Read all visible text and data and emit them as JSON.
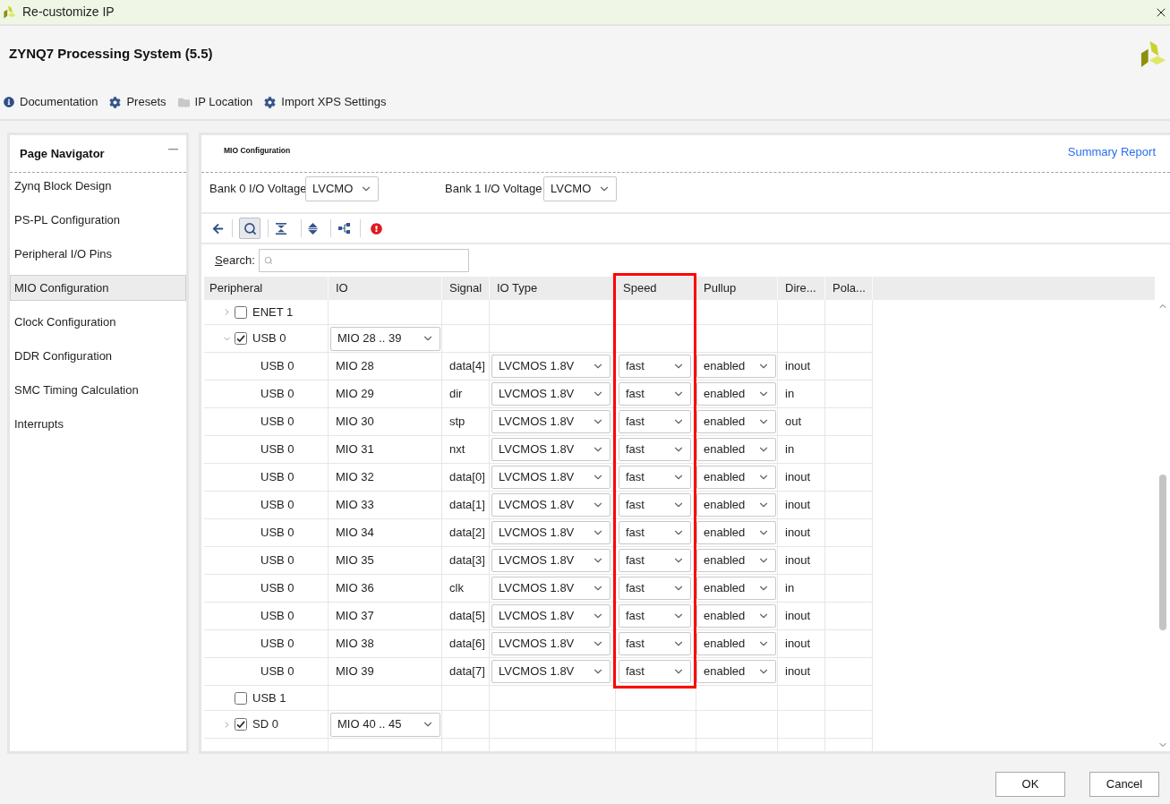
{
  "window": {
    "title": "Re-customize IP"
  },
  "header": {
    "title": "ZYNQ7 Processing System (5.5)",
    "links": [
      {
        "label": "Documentation"
      },
      {
        "label": "Presets"
      },
      {
        "label": "IP Location"
      },
      {
        "label": "Import XPS Settings"
      }
    ]
  },
  "navigator": {
    "title": "Page Navigator",
    "items": [
      {
        "label": "Zynq Block Design",
        "selected": false
      },
      {
        "label": "PS-PL Configuration",
        "selected": false
      },
      {
        "label": "Peripheral I/O Pins",
        "selected": false
      },
      {
        "label": "MIO Configuration",
        "selected": true
      },
      {
        "label": "Clock Configuration",
        "selected": false
      },
      {
        "label": "DDR Configuration",
        "selected": false
      },
      {
        "label": "SMC Timing Calculation",
        "selected": false
      },
      {
        "label": "Interrupts",
        "selected": false
      }
    ]
  },
  "panel": {
    "title": "MIO Configuration",
    "link": "Summary Report",
    "bank_voltages": [
      {
        "label": "Bank 0 I/O Voltage",
        "value": "LVCMO"
      },
      {
        "label": "Bank 1 I/O Voltage",
        "value": "LVCMO"
      }
    ],
    "toolbar": {
      "search_on": true
    },
    "search": {
      "label": "Search:"
    },
    "table": {
      "columns": [
        {
          "label": "Peripheral",
          "highlighted": false
        },
        {
          "label": "IO",
          "highlighted": false
        },
        {
          "label": "Signal",
          "highlighted": false
        },
        {
          "label": "IO Type",
          "highlighted": false
        },
        {
          "label": "Speed",
          "highlighted": true
        },
        {
          "label": "Pullup",
          "highlighted": false
        },
        {
          "label": "Dire...",
          "highlighted": false
        },
        {
          "label": "Pola...",
          "highlighted": false
        }
      ],
      "rows": [
        {
          "kind": "group",
          "peripheral": "ENET 1",
          "checked": false,
          "expanded": false
        },
        {
          "kind": "group",
          "peripheral": "USB 0",
          "checked": true,
          "expanded": true,
          "io": "MIO 28 .. 39",
          "children": [
            {
              "peripheral": "USB 0",
              "io": "MIO 28",
              "signal": "data[4]",
              "io_type": "LVCMOS 1.8V",
              "speed": "fast",
              "pullup": "enabled",
              "direction": "inout"
            },
            {
              "peripheral": "USB 0",
              "io": "MIO 29",
              "signal": "dir",
              "io_type": "LVCMOS 1.8V",
              "speed": "fast",
              "pullup": "enabled",
              "direction": "in"
            },
            {
              "peripheral": "USB 0",
              "io": "MIO 30",
              "signal": "stp",
              "io_type": "LVCMOS 1.8V",
              "speed": "fast",
              "pullup": "enabled",
              "direction": "out"
            },
            {
              "peripheral": "USB 0",
              "io": "MIO 31",
              "signal": "nxt",
              "io_type": "LVCMOS 1.8V",
              "speed": "fast",
              "pullup": "enabled",
              "direction": "in"
            },
            {
              "peripheral": "USB 0",
              "io": "MIO 32",
              "signal": "data[0]",
              "io_type": "LVCMOS 1.8V",
              "speed": "fast",
              "pullup": "enabled",
              "direction": "inout"
            },
            {
              "peripheral": "USB 0",
              "io": "MIO 33",
              "signal": "data[1]",
              "io_type": "LVCMOS 1.8V",
              "speed": "fast",
              "pullup": "enabled",
              "direction": "inout"
            },
            {
              "peripheral": "USB 0",
              "io": "MIO 34",
              "signal": "data[2]",
              "io_type": "LVCMOS 1.8V",
              "speed": "fast",
              "pullup": "enabled",
              "direction": "inout"
            },
            {
              "peripheral": "USB 0",
              "io": "MIO 35",
              "signal": "data[3]",
              "io_type": "LVCMOS 1.8V",
              "speed": "fast",
              "pullup": "enabled",
              "direction": "inout"
            },
            {
              "peripheral": "USB 0",
              "io": "MIO 36",
              "signal": "clk",
              "io_type": "LVCMOS 1.8V",
              "speed": "fast",
              "pullup": "enabled",
              "direction": "in"
            },
            {
              "peripheral": "USB 0",
              "io": "MIO 37",
              "signal": "data[5]",
              "io_type": "LVCMOS 1.8V",
              "speed": "fast",
              "pullup": "enabled",
              "direction": "inout"
            },
            {
              "peripheral": "USB 0",
              "io": "MIO 38",
              "signal": "data[6]",
              "io_type": "LVCMOS 1.8V",
              "speed": "fast",
              "pullup": "enabled",
              "direction": "inout"
            },
            {
              "peripheral": "USB 0",
              "io": "MIO 39",
              "signal": "data[7]",
              "io_type": "LVCMOS 1.8V",
              "speed": "fast",
              "pullup": "enabled",
              "direction": "inout"
            }
          ]
        },
        {
          "kind": "single",
          "peripheral": "USB 1",
          "checked": false
        },
        {
          "kind": "group",
          "peripheral": "SD 0",
          "checked": true,
          "expanded": false,
          "io": "MIO 40 .. 45"
        }
      ]
    }
  },
  "buttons": [
    {
      "label": "OK"
    },
    {
      "label": "Cancel"
    }
  ]
}
